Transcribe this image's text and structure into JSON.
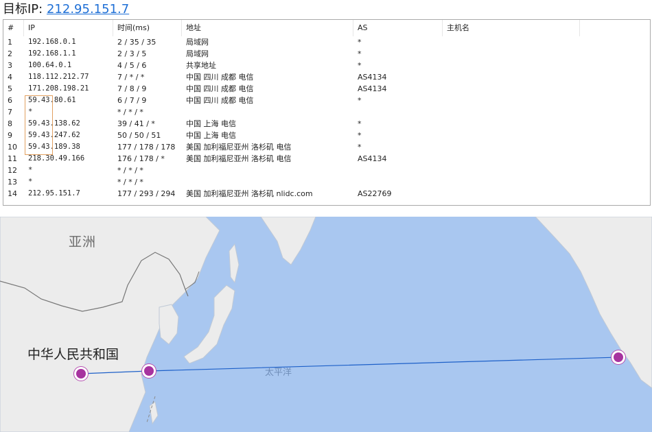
{
  "header": {
    "label": "目标IP:",
    "ip": "212.95.151.7"
  },
  "table": {
    "columns": {
      "num": "#",
      "ip": "IP",
      "time": "时间(ms)",
      "location": "地址",
      "as": "AS",
      "host": "主机名"
    },
    "rows": [
      {
        "num": "1",
        "ip": "192.168.0.1",
        "time": "2 / 35 / 35",
        "location": "局域网",
        "as": "*",
        "host": ""
      },
      {
        "num": "2",
        "ip": "192.168.1.1",
        "time": "2 / 3 / 5",
        "location": "局域网",
        "as": "*",
        "host": ""
      },
      {
        "num": "3",
        "ip": "100.64.0.1",
        "time": "4 / 5 / 6",
        "location": "共享地址",
        "as": "*",
        "host": ""
      },
      {
        "num": "4",
        "ip": "118.112.212.77",
        "time": "7 / * / *",
        "location": "中国 四川 成都 电信",
        "as": "AS4134",
        "host": ""
      },
      {
        "num": "5",
        "ip": "171.208.198.21",
        "time": "7 / 8 / 9",
        "location": "中国 四川 成都 电信",
        "as": "AS4134",
        "host": ""
      },
      {
        "num": "6",
        "ip": "59.43.80.61",
        "time": "6 / 7 / 9",
        "location": "中国 四川 成都 电信",
        "as": "*",
        "host": ""
      },
      {
        "num": "7",
        "ip": "*",
        "time": "* / * / *",
        "location": "",
        "as": "",
        "host": ""
      },
      {
        "num": "8",
        "ip": "59.43.138.62",
        "time": "39 / 41 / *",
        "location": "中国 上海 电信",
        "as": "*",
        "host": ""
      },
      {
        "num": "9",
        "ip": "59.43.247.62",
        "time": "50 / 50 / 51",
        "location": "中国 上海 电信",
        "as": "*",
        "host": ""
      },
      {
        "num": "10",
        "ip": "59.43.189.38",
        "time": "177 / 178 / 178",
        "location": "美国 加利福尼亚州 洛杉矶 电信",
        "as": "*",
        "host": ""
      },
      {
        "num": "11",
        "ip": "218.30.49.166",
        "time": "176 / 178 / *",
        "location": "美国 加利福尼亚州 洛杉矶 电信",
        "as": "AS4134",
        "host": ""
      },
      {
        "num": "12",
        "ip": "*",
        "time": "* / * / *",
        "location": "",
        "as": "",
        "host": ""
      },
      {
        "num": "13",
        "ip": "*",
        "time": "* / * / *",
        "location": "",
        "as": "",
        "host": ""
      },
      {
        "num": "14",
        "ip": "212.95.151.7",
        "time": "177 / 293 / 294",
        "location": "美国 加利福尼亚州 洛杉矶 nlidc.com",
        "as": "AS22769",
        "host": ""
      }
    ]
  },
  "map": {
    "labels": {
      "asia": "亚洲",
      "china": "中华人民共和国",
      "pacific": "太平洋"
    },
    "colors": {
      "ocean": "#a9c7f0",
      "land": "#ececec",
      "route": "#1c5fc8",
      "marker": "#a7339f"
    }
  }
}
